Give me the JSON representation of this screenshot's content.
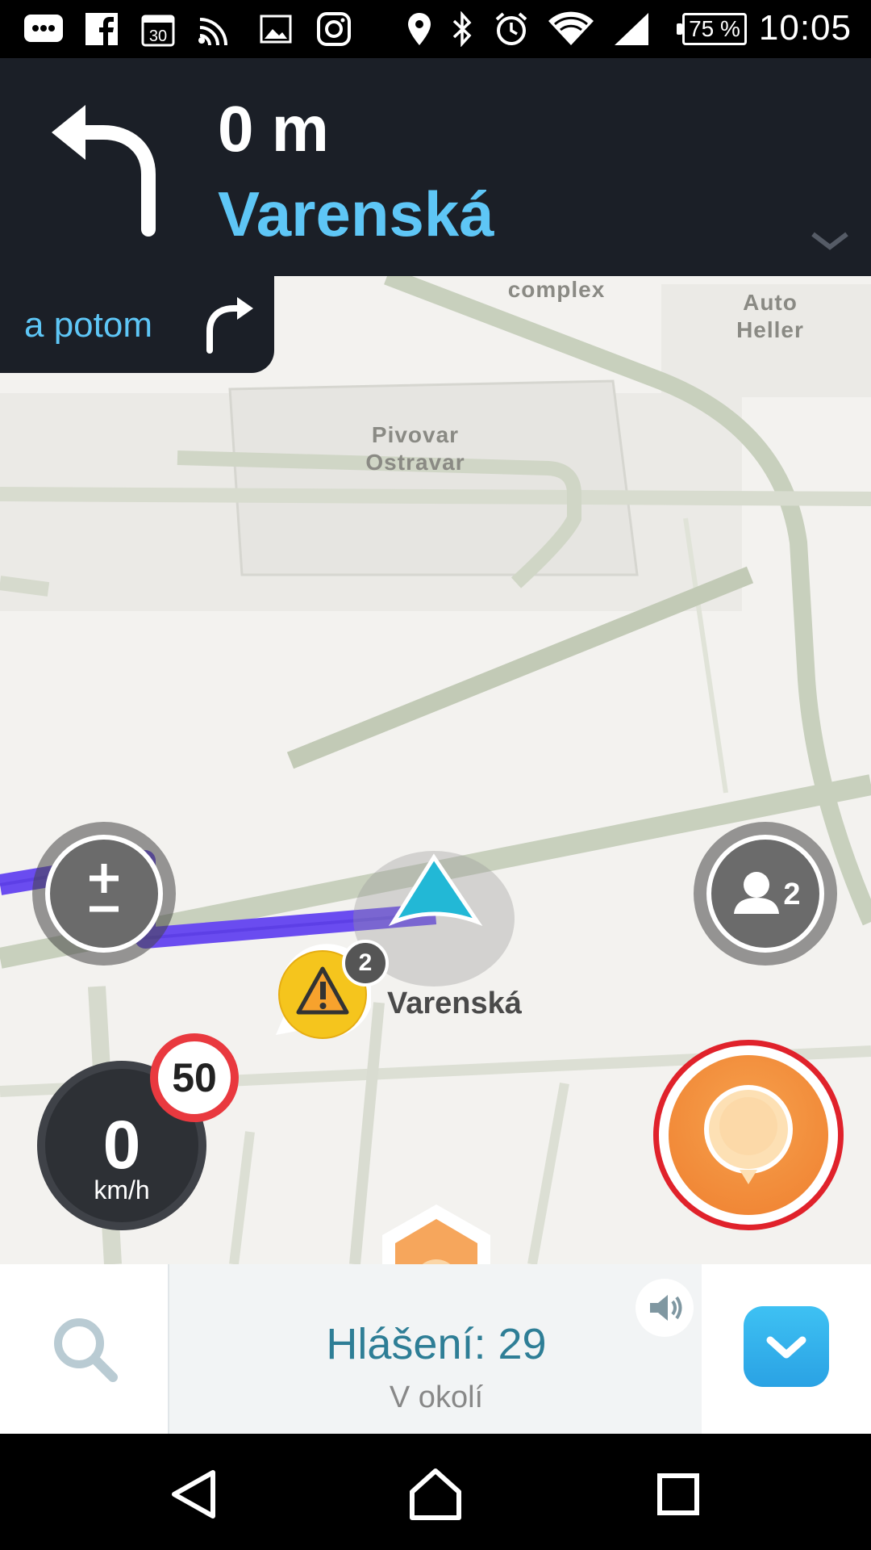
{
  "status_bar": {
    "time": "10:05",
    "battery": "75 %",
    "icons": [
      "messages-icon",
      "facebook-icon",
      "calendar-icon",
      "cast-icon",
      "gallery-icon",
      "instagram-icon",
      "location-icon",
      "bluetooth-icon",
      "alarm-icon",
      "wifi-icon",
      "signal-icon"
    ],
    "calendar_day": "30"
  },
  "navigation": {
    "distance": "0 m",
    "street": "Varenská",
    "then_label": "a potom"
  },
  "map": {
    "labels": [
      {
        "text": "complex"
      },
      {
        "text": "Auto\nHeller"
      },
      {
        "text": "Pivovar\nOstravar"
      }
    ],
    "current_street": "Varenská",
    "alert_count": "2",
    "users_count": "2",
    "speed": "0",
    "speed_unit": "km/h",
    "speed_limit": "50"
  },
  "bottom_bar": {
    "title": "Hlášení: 29",
    "subtitle": "V okolí"
  },
  "colors": {
    "header_bg": "#1b1f27",
    "accent_blue": "#5ec6f6",
    "route": "#6a4cf0",
    "report_orange": "#ef7f2f",
    "limit_red": "#e9393f"
  }
}
